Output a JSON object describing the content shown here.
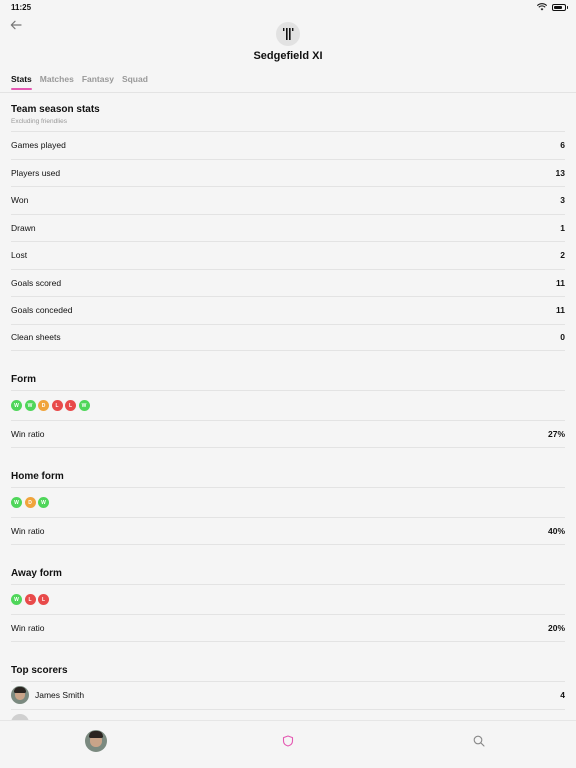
{
  "status": {
    "time": "11:25"
  },
  "team": {
    "name": "Sedgefield XI"
  },
  "tabs": [
    {
      "label": "Stats"
    },
    {
      "label": "Matches"
    },
    {
      "label": "Fantasy"
    },
    {
      "label": "Squad"
    }
  ],
  "season": {
    "title": "Team season stats",
    "subtitle": "Excluding friendlies",
    "rows": [
      {
        "label": "Games played",
        "value": "6"
      },
      {
        "label": "Players used",
        "value": "13"
      },
      {
        "label": "Won",
        "value": "3"
      },
      {
        "label": "Drawn",
        "value": "1"
      },
      {
        "label": "Lost",
        "value": "2"
      },
      {
        "label": "Goals scored",
        "value": "11"
      },
      {
        "label": "Goals conceded",
        "value": "11"
      },
      {
        "label": "Clean sheets",
        "value": "0"
      }
    ]
  },
  "form": {
    "title": "Form",
    "results": [
      "W",
      "W",
      "D",
      "L",
      "L",
      "W"
    ],
    "ratio_label": "Win ratio",
    "ratio_value": "27%"
  },
  "home_form": {
    "title": "Home form",
    "results": [
      "W",
      "D",
      "W"
    ],
    "ratio_label": "Win ratio",
    "ratio_value": "40%"
  },
  "away_form": {
    "title": "Away form",
    "results": [
      "W",
      "L",
      "L"
    ],
    "ratio_label": "Win ratio",
    "ratio_value": "20%"
  },
  "top_scorers": {
    "title": "Top scorers",
    "players": [
      {
        "name": "James Smith",
        "goals": "4"
      }
    ]
  },
  "colors": {
    "accent": "#e458b2",
    "win": "#4fd65a",
    "draw": "#f0a43c",
    "loss": "#e84a4a"
  },
  "nav": {
    "icons": [
      "profile-avatar",
      "shield-icon",
      "search-icon"
    ]
  }
}
